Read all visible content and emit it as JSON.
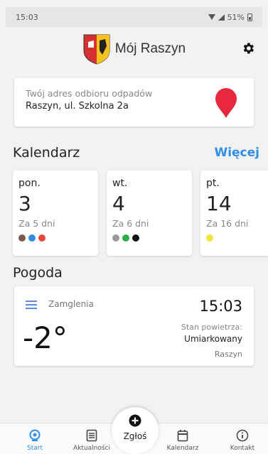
{
  "status_bar": {
    "time": "15:03",
    "battery": "51%"
  },
  "header": {
    "title": "Mój Raszyn"
  },
  "address": {
    "label": "Twój adres odbioru odpadów",
    "value": "Raszyn, ul. Szkolna 2a"
  },
  "calendar": {
    "title": "Kalendarz",
    "more": "Więcej",
    "days": [
      {
        "day": "pon.",
        "date": "3",
        "in": "Za 5 dni",
        "dots": [
          "#7b5b4a",
          "#2f8fe8",
          "#e8453c"
        ]
      },
      {
        "day": "wt.",
        "date": "4",
        "in": "Za 6 dni",
        "dots": [
          "#9a9a9a",
          "#2eab4a",
          "#111111"
        ]
      },
      {
        "day": "pt.",
        "date": "14",
        "in": "Za 16 dni",
        "dots": [
          "#f5e43a"
        ]
      }
    ]
  },
  "weather": {
    "title": "Pogoda",
    "description": "Zamglenia",
    "temperature": "-2°",
    "time": "15:03",
    "air_label": "Stan powietrza:",
    "air_value": "Umiarkowany",
    "place": "Raszyn"
  },
  "nav": {
    "start": "Start",
    "news": "Aktualności",
    "report": "Zgłoś",
    "calendar": "Kalendarz",
    "contact": "Kontakt"
  },
  "colors": {
    "accent": "#2f8fe8",
    "pin": "#e8283c"
  },
  "icons": {
    "crest": "crest-icon",
    "settings": "gear-icon",
    "pin": "location-pin-icon",
    "weather": "fog-icon",
    "start": "home-icon",
    "news": "news-icon",
    "report": "plus-circle-icon",
    "calendar": "calendar-icon",
    "contact": "info-icon"
  }
}
